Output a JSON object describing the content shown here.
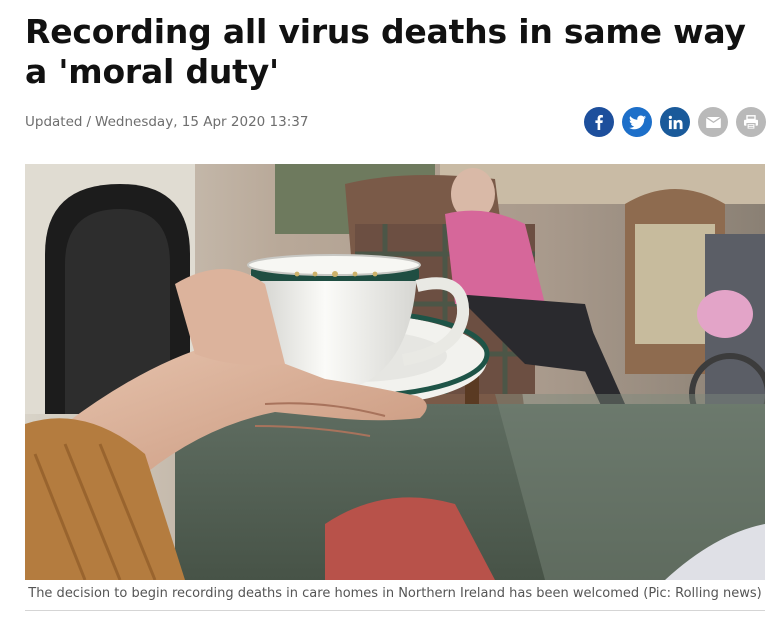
{
  "article": {
    "headline": "Recording all virus deaths in same way a 'moral duty'",
    "updated_label": "Updated",
    "separator": "/",
    "updated_date": "Wednesday, 15 Apr 2020 13:37",
    "image_caption": "The decision to begin recording deaths in care homes in Northern Ireland has been welcomed (Pic: Rolling news)"
  },
  "share": {
    "buttons": [
      {
        "icon": "facebook-icon",
        "color": "#1d4f9c"
      },
      {
        "icon": "twitter-icon",
        "color": "#1d6fc9"
      },
      {
        "icon": "linkedin-icon",
        "color": "#1a5a9a"
      },
      {
        "icon": "email-icon",
        "color": "#b9b9b9"
      },
      {
        "icon": "print-icon",
        "color": "#b9b9b9"
      }
    ]
  }
}
